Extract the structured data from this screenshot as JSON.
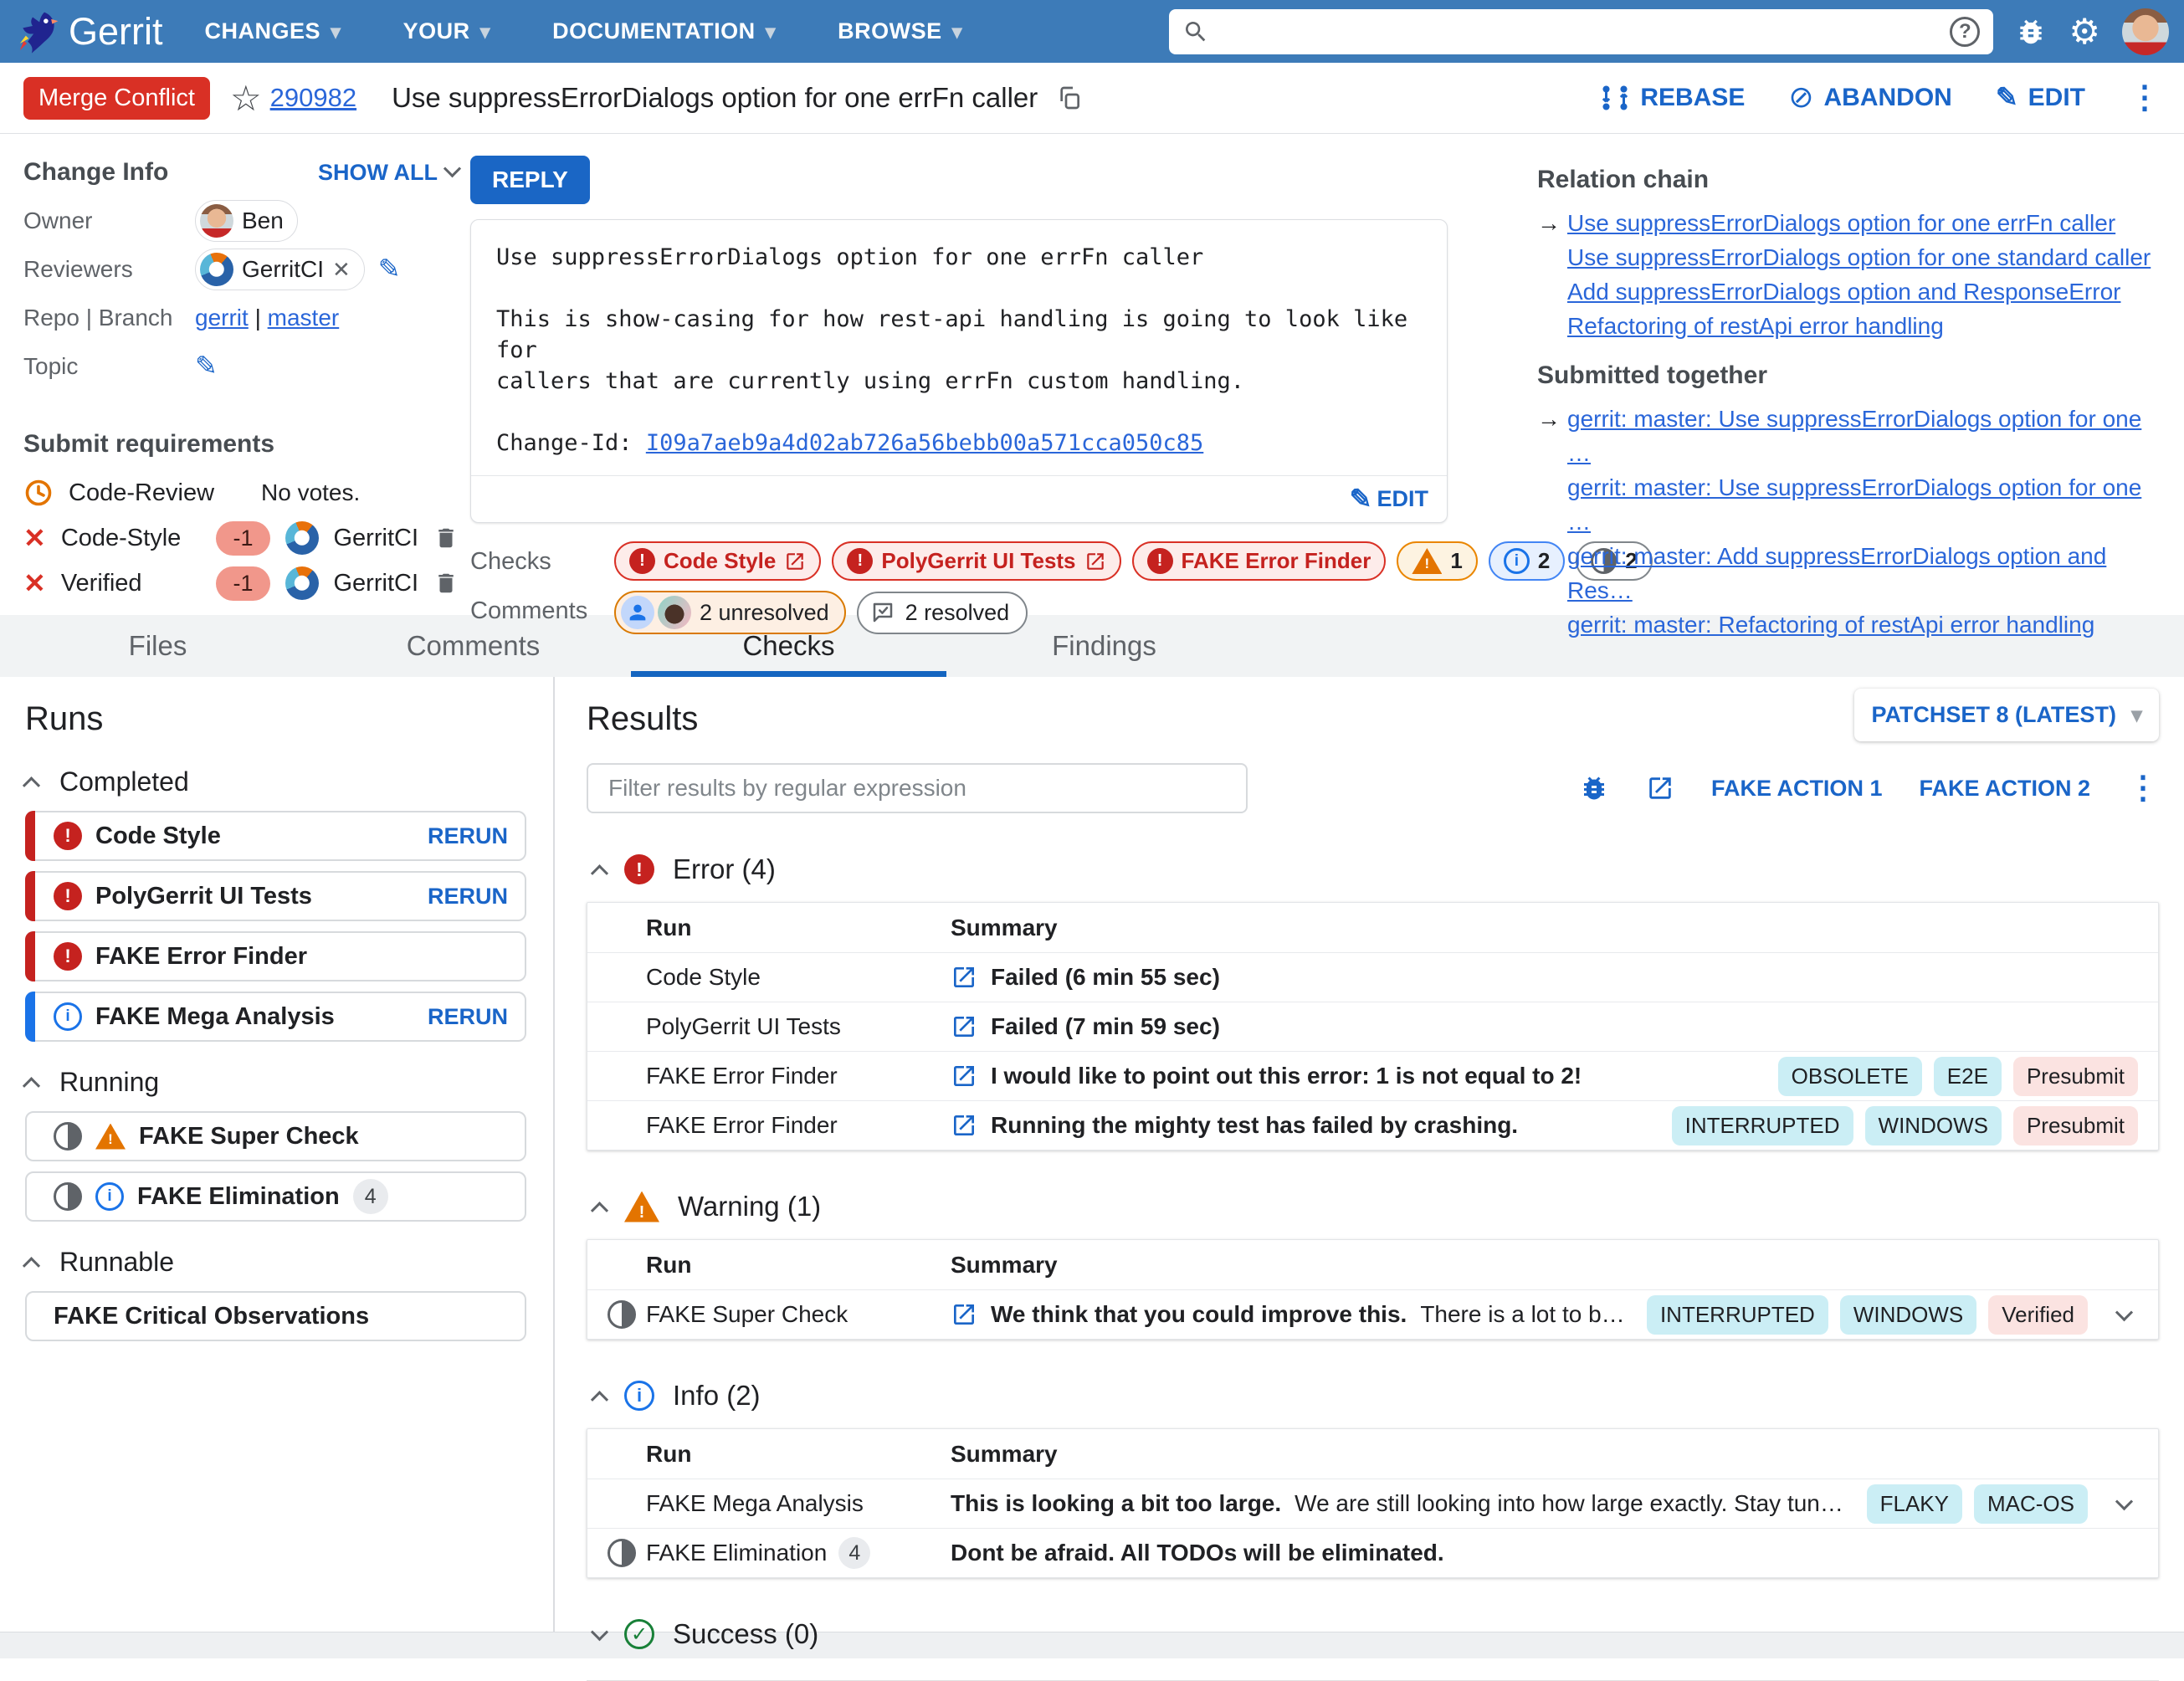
{
  "palette": {
    "nav_blue": "#3d7bb8",
    "accent_blue": "#1a65c8",
    "link_blue": "#2a66d9",
    "error_red": "#c5221f",
    "badge_red": "#d93025",
    "warning_orange": "#e37400",
    "success_green": "#188038",
    "tag_cyan": "#cbeef5",
    "tag_pink": "#fbe3e1",
    "tab_bg": "#f1f3f4"
  },
  "nav": {
    "brand": "Gerrit",
    "menus": [
      {
        "label": "CHANGES"
      },
      {
        "label": "YOUR"
      },
      {
        "label": "DOCUMENTATION"
      },
      {
        "label": "BROWSE"
      }
    ]
  },
  "header": {
    "status": "Merge Conflict",
    "change_number": "290982",
    "title": "Use suppressErrorDialogs option for one errFn caller",
    "rebase": "REBASE",
    "abandon": "ABANDON",
    "edit": "EDIT"
  },
  "change_info": {
    "heading": "Change Info",
    "show_all": "SHOW ALL",
    "owner_label": "Owner",
    "owner": "Ben",
    "reviewers_label": "Reviewers",
    "reviewer": "GerritCI",
    "repo_branch_label": "Repo | Branch",
    "repo": "gerrit",
    "branch_sep": "|",
    "branch": "master",
    "topic_label": "Topic"
  },
  "submit_requirements": {
    "heading": "Submit requirements",
    "code_review": {
      "name": "Code-Review",
      "note": "No votes."
    },
    "code_style": {
      "name": "Code-Style",
      "vote": "-1",
      "by": "GerritCI"
    },
    "verified": {
      "name": "Verified",
      "vote": "-1",
      "by": "GerritCI"
    }
  },
  "commit": {
    "reply": "REPLY",
    "title_line": "Use suppressErrorDialogs option for one errFn caller",
    "body_line1": "This is show-casing for how rest-api handling is going to look like for",
    "body_line2": "callers that are currently using errFn custom handling.",
    "change_id_label": "Change-Id: ",
    "change_id": "I09a7aeb9a4d02ab726a56bebb00a571cca050c85",
    "edit": "EDIT"
  },
  "status_row": {
    "checks_label": "Checks",
    "chips": [
      {
        "label": "Code Style"
      },
      {
        "label": "PolyGerrit UI Tests"
      },
      {
        "label": "FAKE Error Finder"
      }
    ],
    "warning_count": "1",
    "info_count": "2",
    "running_count": "2",
    "comments_label": "Comments",
    "unresolved": "2 unresolved",
    "resolved": "2 resolved"
  },
  "relation_chain": {
    "heading": "Relation chain",
    "items": [
      {
        "label": "Use suppressErrorDialogs option for one errFn caller"
      },
      {
        "label": "Use suppressErrorDialogs option for one standard caller"
      },
      {
        "label": "Add suppressErrorDialogs option and ResponseError"
      },
      {
        "label": "Refactoring of restApi error handling"
      }
    ]
  },
  "submitted_together": {
    "heading": "Submitted together",
    "items": [
      {
        "label": "gerrit: master: Use suppressErrorDialogs option for one …"
      },
      {
        "label": "gerrit: master: Use suppressErrorDialogs option for one …"
      },
      {
        "label": "gerrit: master: Add suppressErrorDialogs option and Res…"
      },
      {
        "label": "gerrit: master: Refactoring of restApi error handling"
      }
    ]
  },
  "tabs": [
    {
      "label": "Files"
    },
    {
      "label": "Comments"
    },
    {
      "label": "Checks"
    },
    {
      "label": "Findings"
    }
  ],
  "runs": {
    "title": "Runs",
    "completed": "Completed",
    "running": "Running",
    "runnable": "Runnable",
    "rerun": "RERUN",
    "completed_items": [
      {
        "name": "Code Style"
      },
      {
        "name": "PolyGerrit UI Tests"
      },
      {
        "name": "FAKE Error Finder"
      },
      {
        "name": "FAKE Mega Analysis"
      }
    ],
    "running_items": [
      {
        "name": "FAKE Super Check"
      },
      {
        "name": "FAKE Elimination",
        "badge": "4"
      }
    ],
    "runnable_items": [
      {
        "name": "FAKE Critical Observations"
      }
    ]
  },
  "results": {
    "title": "Results",
    "patchset": "PATCHSET 8 (LATEST)",
    "filter_placeholder": "Filter results by regular expression",
    "action1": "FAKE ACTION 1",
    "action2": "FAKE ACTION 2",
    "columns": {
      "run": "Run",
      "summary": "Summary"
    },
    "error": {
      "label": "Error (4)",
      "rows": [
        {
          "run": "Code Style",
          "summary": "Failed (6 min 55 sec)"
        },
        {
          "run": "PolyGerrit UI Tests",
          "summary": "Failed (7 min 59 sec)"
        },
        {
          "run": "FAKE Error Finder",
          "summary": "I would like to point out this error: 1 is not equal to 2!",
          "tags": [
            {
              "label": "OBSOLETE"
            },
            {
              "label": "E2E"
            },
            {
              "label": "Presubmit"
            }
          ]
        },
        {
          "run": "FAKE Error Finder",
          "summary": "Running the mighty test has failed by crashing.",
          "tags": [
            {
              "label": "INTERRUPTED"
            },
            {
              "label": "WINDOWS"
            },
            {
              "label": "Presubmit"
            }
          ]
        }
      ]
    },
    "warning": {
      "label": "Warning (1)",
      "rows": [
        {
          "run": "FAKE Super Check",
          "summary": "We think that you could improve this.",
          "summary_rest": "There is a lot to be said....",
          "tags": [
            {
              "label": "INTERRUPTED"
            },
            {
              "label": "WINDOWS"
            },
            {
              "label": "Verified"
            }
          ]
        }
      ]
    },
    "info": {
      "label": "Info (2)",
      "rows": [
        {
          "run": "FAKE Mega Analysis",
          "summary": "This is looking a bit too large.",
          "summary_rest": "We are still looking into how large exactly. Stay tuned. An…",
          "tags": [
            {
              "label": "FLAKY"
            },
            {
              "label": "MAC-OS"
            }
          ]
        },
        {
          "run": "FAKE Elimination",
          "badge": "4",
          "summary": "Dont be afraid. All TODOs will be eliminated."
        }
      ]
    },
    "success": {
      "label": "Success (0)"
    }
  }
}
